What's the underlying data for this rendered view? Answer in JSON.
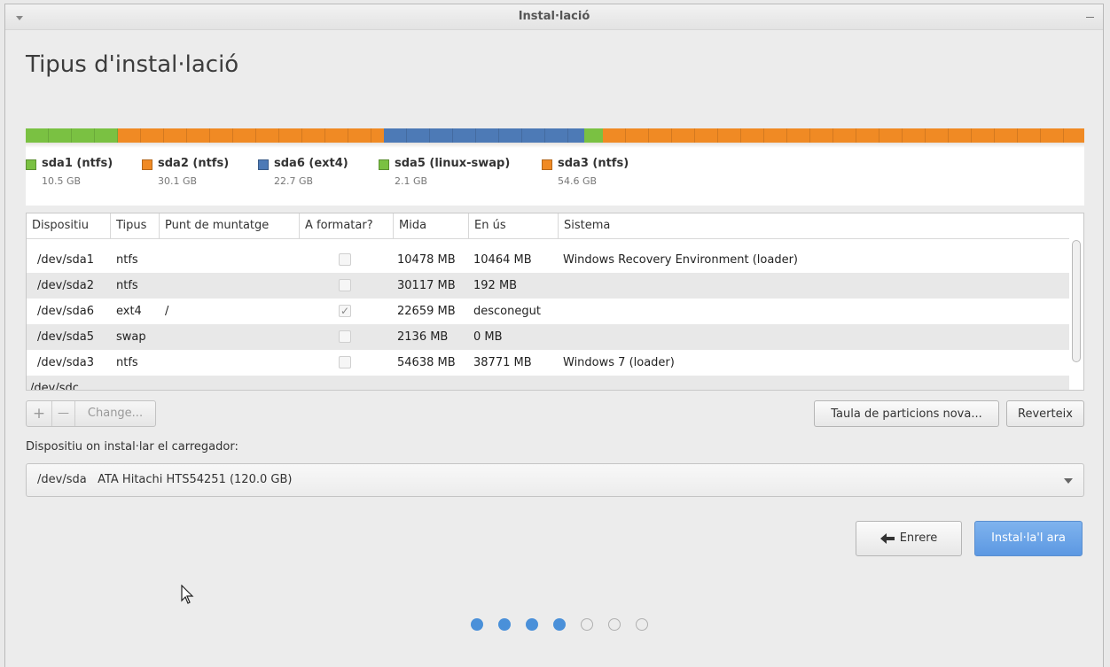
{
  "window": {
    "title": "Instal·lació"
  },
  "page": {
    "title": "Tipus d'instal·lació"
  },
  "partition_bar": {
    "segments": [
      {
        "name": "sda1",
        "color": "#7ac142",
        "size_gb": 10.5
      },
      {
        "name": "sda2",
        "color": "#f08a24",
        "size_gb": 30.1
      },
      {
        "name": "sda6",
        "color": "#4d7ab6",
        "size_gb": 22.7
      },
      {
        "name": "sda5",
        "color": "#7ac142",
        "size_gb": 2.1
      },
      {
        "name": "sda3",
        "color": "#f08a24",
        "size_gb": 54.6
      }
    ],
    "legend": [
      {
        "label": "sda1 (ntfs)",
        "size": "10.5 GB",
        "color": "#7ac142"
      },
      {
        "label": "sda2 (ntfs)",
        "size": "30.1 GB",
        "color": "#f08a24"
      },
      {
        "label": "sda6 (ext4)",
        "size": "22.7 GB",
        "color": "#4d7ab6"
      },
      {
        "label": "sda5 (linux-swap)",
        "size": "2.1 GB",
        "color": "#7ac142"
      },
      {
        "label": "sda3 (ntfs)",
        "size": "54.6 GB",
        "color": "#f08a24"
      }
    ]
  },
  "table": {
    "columns": [
      "Dispositiu",
      "Tipus",
      "Punt de muntatge",
      "A formatar?",
      "Mida",
      "En ús",
      "Sistema"
    ],
    "rows": [
      {
        "device": "/dev/sda1",
        "type": "ntfs",
        "mount": "",
        "format": false,
        "size": "10478 MB",
        "used": "10464 MB",
        "system": "Windows Recovery Environment (loader)"
      },
      {
        "device": "/dev/sda2",
        "type": "ntfs",
        "mount": "",
        "format": false,
        "size": "30117 MB",
        "used": "192 MB",
        "system": ""
      },
      {
        "device": "/dev/sda6",
        "type": "ext4",
        "mount": "/",
        "format": true,
        "size": "22659 MB",
        "used": "desconegut",
        "system": ""
      },
      {
        "device": "/dev/sda5",
        "type": "swap",
        "mount": "",
        "format": false,
        "size": "2136 MB",
        "used": "0 MB",
        "system": ""
      },
      {
        "device": "/dev/sda3",
        "type": "ntfs",
        "mount": "",
        "format": false,
        "size": "54638 MB",
        "used": "38771 MB",
        "system": "Windows 7 (loader)"
      }
    ],
    "partial_row": "/dev/sdc"
  },
  "toolbar": {
    "add": "+",
    "remove": "—",
    "change": "Change...",
    "new_table": "Taula de particions nova...",
    "revert": "Reverteix"
  },
  "bootloader": {
    "label": "Dispositiu on instal·lar el carregador:",
    "selected": "/dev/sda   ATA Hitachi HTS54251 (120.0 GB)"
  },
  "nav": {
    "back": "Enrere",
    "install": "Instal·la'l ara"
  },
  "progress": {
    "total_steps": 7,
    "current_step": 4
  }
}
